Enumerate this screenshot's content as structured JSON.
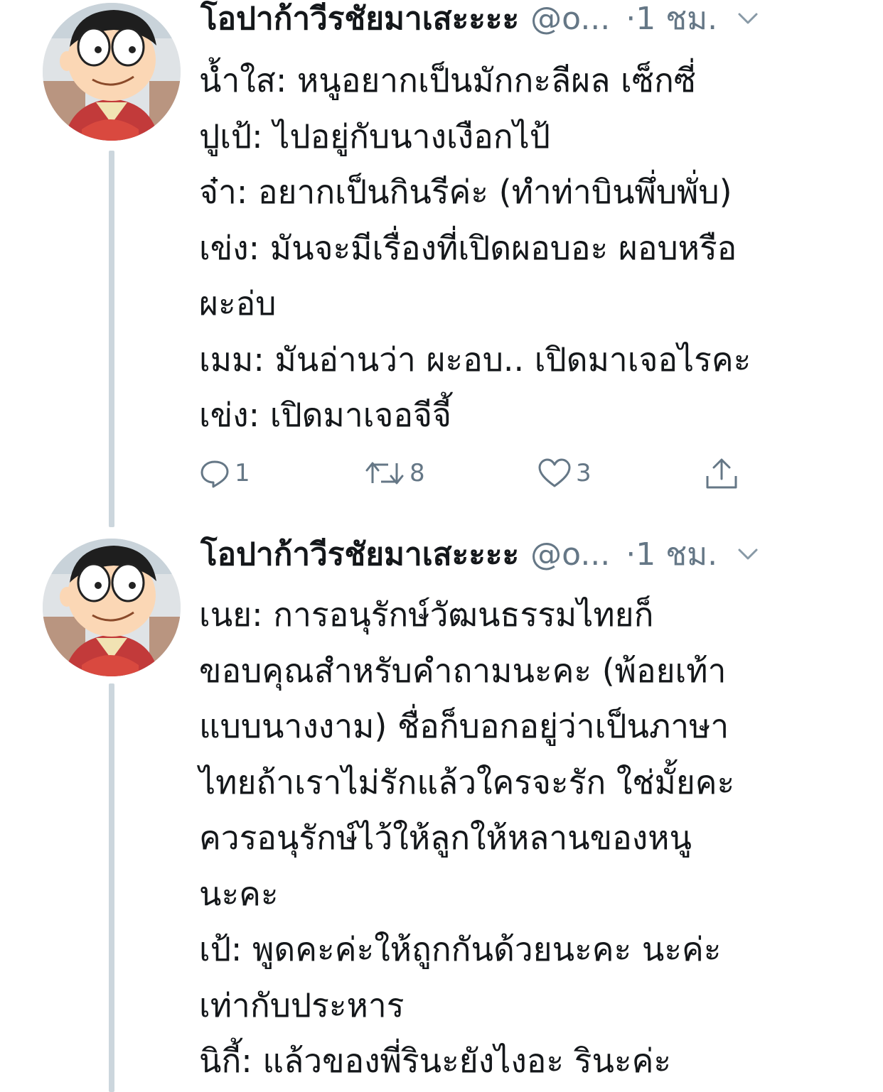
{
  "tweets": [
    {
      "display_name": "โอปาก้าวีรชัยมาเสะะะะ",
      "handle": "@o...",
      "time": "·1 ชม.",
      "lines": [
        "น้ำใส: หนูอยากเป็นมักกะลีผล เซ็กซี่",
        "ปูเป้: ไปอยู่กับนางเงือกไป้",
        "จ๋า: อยากเป็นกินรีค่ะ (ทำท่าบินพึ่บพั่บ)",
        "เข่ง: มันจะมีเรื่องที่เปิดผอบอะ ผอบหรือ",
        "ผะอ่บ",
        "เมม: มันอ่านว่า ผะอบ.. เปิดมาเจอไรคะ",
        "เข่ง: เปิดมาเจอจีจี้"
      ],
      "reply_count": "1",
      "retweet_count": "8",
      "like_count": "3"
    },
    {
      "display_name": "โอปาก้าวีรชัยมาเสะะะะ",
      "handle": "@o...",
      "time": "·1 ชม.",
      "lines": [
        "เนย: การอนุรักษ์วัฒนธรรมไทยก็",
        "ขอบคุณสำหรับคำถามนะคะ (พ้อยเท้า",
        "แบบนางงาม) ชื่อก็บอกอยู่ว่าเป็นภาษา",
        "ไทยถ้าเราไม่รักแล้วใครจะรัก ใช่มั้ยคะ",
        "ควรอนุรักษ์ไว้ให้ลูกให้หลานของหนู",
        "นะคะ",
        "เป้: พูดคะค่ะให้ถูกกันด้วยนะคะ นะค่ะ",
        "เท่ากับประหาร",
        "นิกี้: แล้วของพี่รินะยังไงอะ รินะค่ะ"
      ]
    }
  ],
  "icons": {
    "avatar": "cartoon-boy-avatar",
    "reply": "speech-bubble-icon",
    "retweet": "retweet-arrows-icon",
    "like": "heart-icon",
    "share": "share-upload-icon",
    "more": "chevron-down-icon"
  },
  "colors": {
    "text": "#14171a",
    "secondary": "#657786",
    "thread_line": "#ccd6dd"
  }
}
